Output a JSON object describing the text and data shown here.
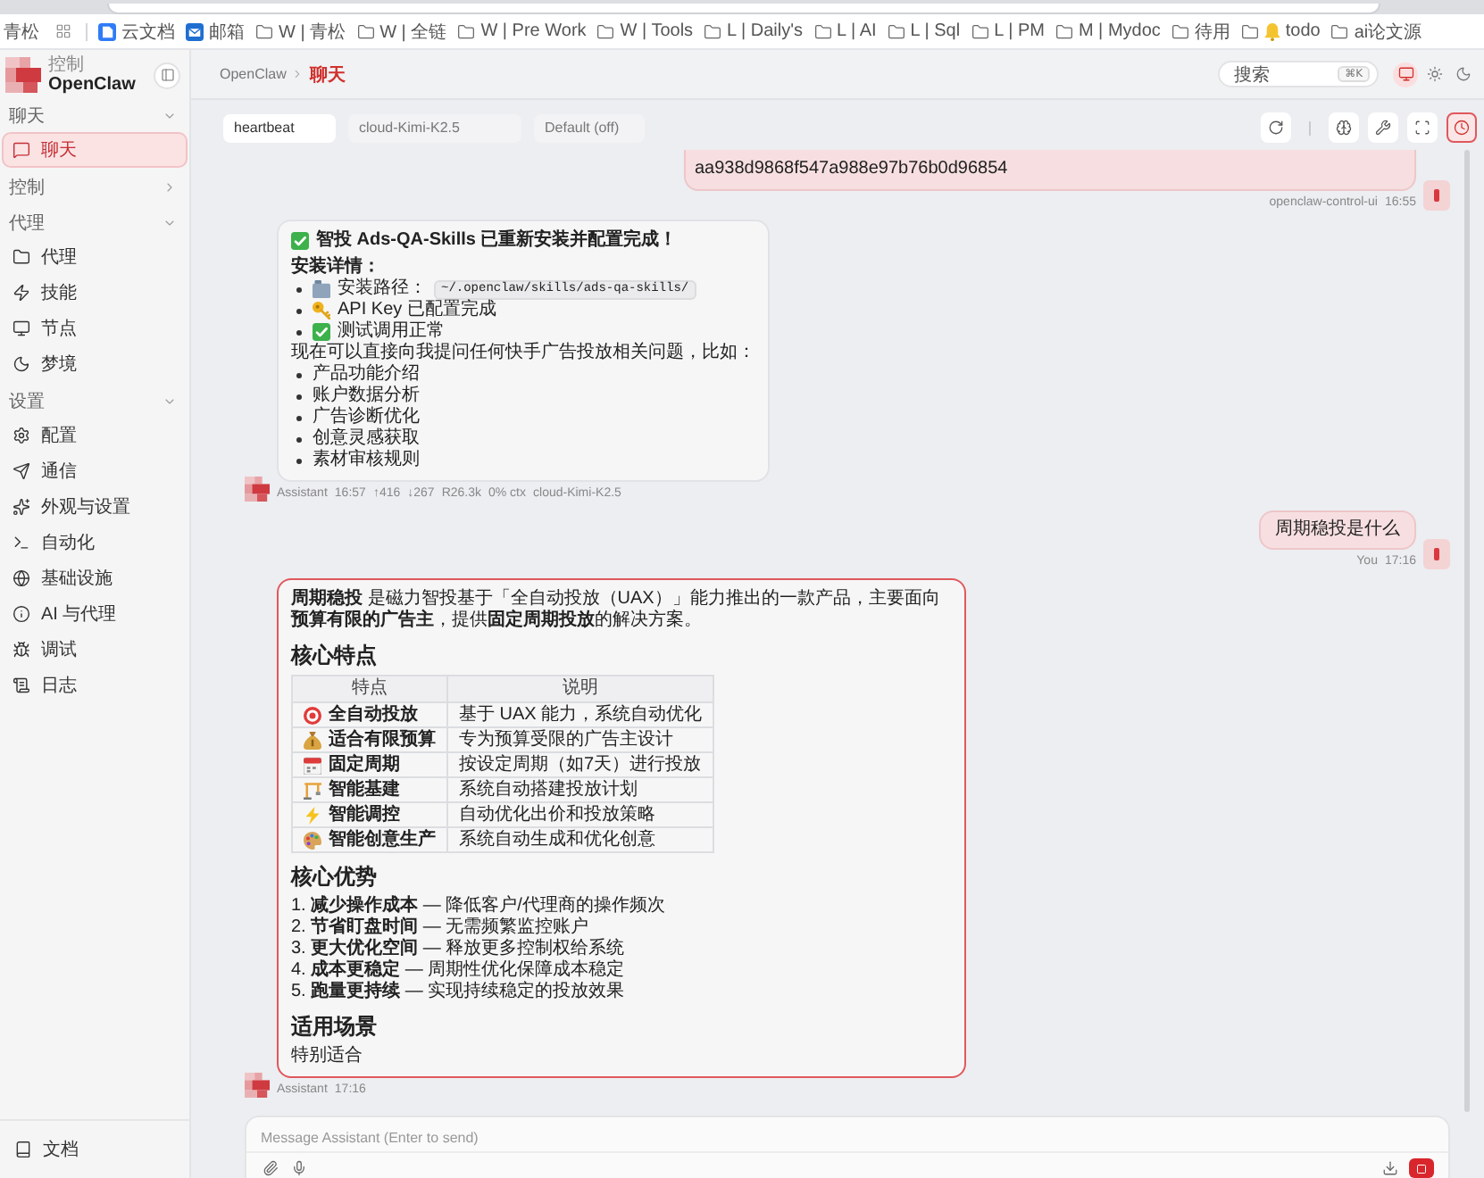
{
  "browser": {
    "bookmarks": [
      {
        "label": "青松",
        "kind": "plain"
      },
      {
        "kind": "apps"
      },
      {
        "label": "云文档",
        "kind": "doc"
      },
      {
        "label": "邮箱",
        "kind": "mail"
      },
      {
        "label": "W | 青松",
        "kind": "folder"
      },
      {
        "label": "W | 全链",
        "kind": "folder"
      },
      {
        "label": "W | Pre Work",
        "kind": "folder"
      },
      {
        "label": "W | Tools",
        "kind": "folder"
      },
      {
        "label": "L | Daily's",
        "kind": "folder"
      },
      {
        "label": "L | AI",
        "kind": "folder"
      },
      {
        "label": "L | Sql",
        "kind": "folder"
      },
      {
        "label": "L | PM",
        "kind": "folder"
      },
      {
        "label": "M | Mydoc",
        "kind": "folder"
      },
      {
        "label": "待用",
        "kind": "folder"
      },
      {
        "label": "todo",
        "kind": "folder-emoji"
      },
      {
        "label": "ai论文源",
        "kind": "folder"
      }
    ]
  },
  "sidebar": {
    "brand": {
      "caption": "控制",
      "name": "OpenClaw"
    },
    "sections": [
      {
        "label": "聊天",
        "expanded": true,
        "items": [
          {
            "label": "聊天",
            "selected": true
          }
        ]
      },
      {
        "label": "控制",
        "expanded": false
      },
      {
        "label": "代理",
        "expanded": true,
        "items": [
          {
            "label": "代理",
            "selected": false
          },
          {
            "label": "技能",
            "selected": false
          },
          {
            "label": "节点",
            "selected": false
          },
          {
            "label": "梦境",
            "selected": false
          }
        ]
      },
      {
        "label": "设置",
        "expanded": true,
        "items": [
          {
            "label": "配置",
            "selected": false
          },
          {
            "label": "通信",
            "selected": false
          },
          {
            "label": "外观与设置",
            "selected": false
          },
          {
            "label": "自动化",
            "selected": false
          },
          {
            "label": "基础设施",
            "selected": false
          },
          {
            "label": "AI 与代理",
            "selected": false
          },
          {
            "label": "调试",
            "selected": false
          },
          {
            "label": "日志",
            "selected": false
          }
        ]
      }
    ],
    "footer": {
      "label": "文档"
    }
  },
  "header": {
    "breadcrumb": [
      {
        "label": "OpenClaw",
        "current": false
      },
      {
        "label": "聊天",
        "current": true
      }
    ],
    "search": {
      "label": "搜索",
      "shortcut": "⌘K"
    },
    "theme_options": [
      {
        "selected": true
      },
      {
        "selected": false
      },
      {
        "selected": false
      }
    ]
  },
  "chat_toolbar": {
    "session": "heartbeat",
    "model": "cloud-Kimi-K2.5",
    "thinking": "Default (off)",
    "tools": [
      {
        "selected": false
      },
      {
        "selected": false
      },
      {
        "selected": false
      },
      {
        "selected": false
      },
      {
        "selected": true
      }
    ]
  },
  "messages": [
    {
      "kind": "user",
      "clipped": true,
      "text": "aa938d9868f547a988e97b76b0d96854",
      "sender": "openclaw-control-ui",
      "time": "16:55"
    },
    {
      "kind": "report",
      "highlighted": false,
      "title": "智投 Ads-QA-Skills 已重新安装并配置完成！",
      "details_heading": "安装详情：",
      "details": [
        {
          "text": "安装路径：",
          "code": "~/.openclaw/skills/ads-qa-skills/"
        },
        {
          "text": "API Key 已配置完成"
        },
        {
          "text": "测试调用正常"
        }
      ],
      "intro": "现在可以直接向我提问任何快手广告投放相关问题，比如：",
      "examples": [
        "产品功能介绍",
        "账户数据分析",
        "广告诊断优化",
        "创意灵感获取",
        "素材审核规则"
      ],
      "sender": "Assistant",
      "time": "16:57",
      "stats": [
        "↑416",
        "↓267",
        "R26.3k",
        "0% ctx",
        "cloud-Kimi-K2.5"
      ]
    },
    {
      "kind": "user",
      "clipped": false,
      "text": "周期稳投是什么",
      "sender": "You",
      "time": "17:16"
    },
    {
      "kind": "answer",
      "highlighted": true,
      "summary": "**周期稳投** 是磁力智投基于「全自动投放（UAX）」能力推出的一款产品，主要面向**预算有限的广告主**，提供**固定周期投放**的解决方案。",
      "sections": [
        {
          "kind": "table",
          "heading": "核心特点",
          "columns": [
            "特点",
            "说明"
          ],
          "rows": [
            [
              "全自动投放",
              "基于 UAX 能力，系统自动优化"
            ],
            [
              "适合有限预算",
              "专为预算受限的广告主设计"
            ],
            [
              "固定周期",
              "按设定周期（如7天）进行投放"
            ],
            [
              "智能基建",
              "系统自动搭建投放计划"
            ],
            [
              "智能调控",
              "自动优化出价和投放策略"
            ],
            [
              "智能创意生产",
              "系统自动生成和优化创意"
            ]
          ]
        },
        {
          "kind": "ordered",
          "heading": "核心优势",
          "items": [
            "1. **减少操作成本** — 降低客户/代理商的操作频次",
            "2. **节省盯盘时间** — 无需频繁监控账户",
            "3. **更大优化空间** — 释放更多控制权给系统",
            "4. **成本更稳定** — 周期性优化保障成本稳定",
            "5. **跑量更持续** — 实现持续稳定的投放效果"
          ]
        },
        {
          "kind": "text",
          "heading": "适用场景",
          "text": "特别适合"
        }
      ],
      "sender": "Assistant",
      "time": "17:16"
    }
  ],
  "composer": {
    "placeholder": "Message Assistant (Enter to send)"
  }
}
